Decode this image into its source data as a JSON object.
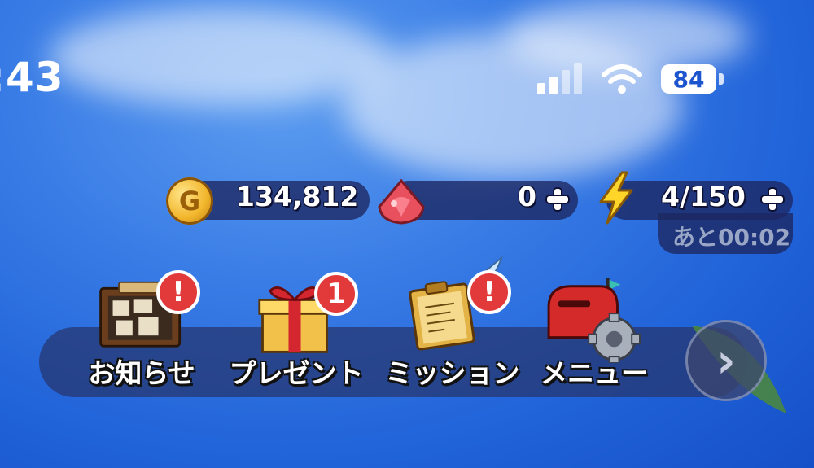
{
  "status_bar": {
    "time": ":43",
    "battery": "84"
  },
  "currencies": {
    "gold": {
      "icon": "gold-coin-icon",
      "coin_letter": "G",
      "value": "134,812"
    },
    "gems": {
      "icon": "gem-icon",
      "value": "0"
    },
    "stamina": {
      "icon": "lightning-icon",
      "value": "4/150",
      "recover_time": "あと00:02"
    }
  },
  "menu": [
    {
      "label": "お知らせ",
      "icon": "notice-board-icon",
      "badge": "!"
    },
    {
      "label": "プレゼント",
      "icon": "gift-box-icon",
      "badge": "1"
    },
    {
      "label": "ミッション",
      "icon": "mission-clipboard-icon",
      "badge": "!"
    },
    {
      "label": "メニュー",
      "icon": "mailbox-gear-icon",
      "badge": ""
    }
  ],
  "next_button": {
    "icon": "chevron-right-icon",
    "glyph": "›"
  },
  "colors": {
    "badge": "#e23a3a",
    "pill_bg": "#1c2660",
    "sky": "#2062d8"
  }
}
